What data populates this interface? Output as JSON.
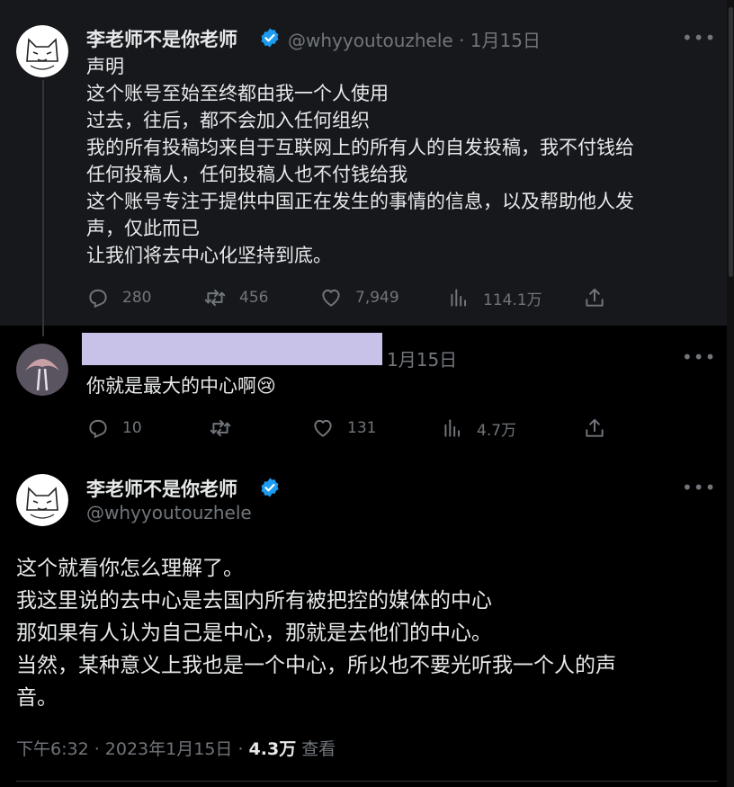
{
  "tweet1": {
    "author_name": "李老师不是你老师",
    "handle": "@whyyoutouzhele",
    "date": "1月15日",
    "lines": [
      "声明",
      "这个账号至始至终都由我一个人使用",
      "过去，往后，都不会加入任何组织",
      "我的所有投稿均来自于互联网上的所有人的自发投稿，我不付钱给",
      "任何投稿人，任何投稿人也不付钱给我",
      "这个账号专注于提供中国正在发生的事情的信息，以及帮助他人发",
      "声，仅此而已",
      "让我们将去中心化坚持到底。"
    ],
    "replies": "280",
    "retweets": "456",
    "likes": "7,949",
    "views": "114.1万"
  },
  "tweet2": {
    "date": "1月15日",
    "text": "你就是最大的中心啊😢",
    "replies": "10",
    "likes": "131",
    "views": "4.7万"
  },
  "tweet3": {
    "author_name": "李老师不是你老师",
    "handle": "@whyyoutouzhele",
    "lines": [
      "这个就看你怎么理解了。",
      "我这里说的去中心是去国内所有被把控的媒体的中心",
      "那如果有人认为自己是中心，那就是去他们的中心。",
      "当然，某种意义上我也是一个中心，所以也不要光听我一个人的声",
      "音。"
    ],
    "time": "下午6:32 · 2023年1月15日 · ",
    "view_count": "4.3万",
    "views_label": "查看"
  },
  "more_label": "•••",
  "colors": {
    "verified": "#1d9bf0",
    "background": "#000000",
    "muted": "#71767b"
  }
}
